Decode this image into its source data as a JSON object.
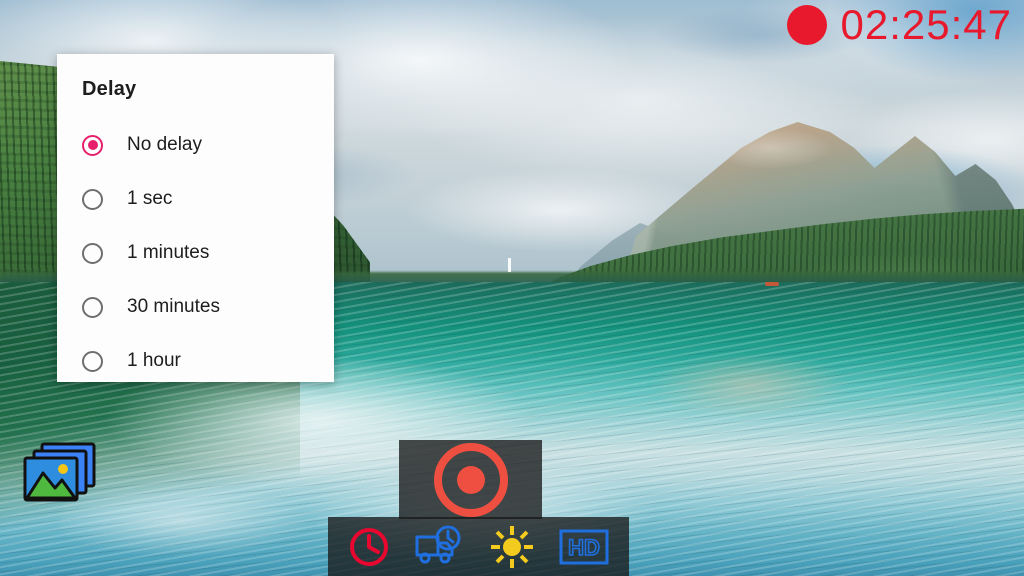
{
  "app": {
    "name": "camera-recorder",
    "viewfinder_scene": "mountain-lake-landscape"
  },
  "recording": {
    "indicator_icon": "record-dot-icon",
    "elapsed_time": "02:25:47",
    "color": "#e8192c",
    "is_recording": true
  },
  "dialog": {
    "title": "Delay",
    "selected_index": 0,
    "accent_color": "#e8206c",
    "options": [
      {
        "label": "No delay",
        "selected": true
      },
      {
        "label": "1 sec",
        "selected": false
      },
      {
        "label": "1 minutes",
        "selected": false
      },
      {
        "label": "30 minutes",
        "selected": false
      },
      {
        "label": "1 hour",
        "selected": false
      }
    ]
  },
  "gallery": {
    "icon": "gallery-stack-icon",
    "label": "Gallery"
  },
  "controls": {
    "record_button": {
      "icon": "record-circle-icon",
      "label": "Record",
      "color": "#ef4f41"
    },
    "tools": [
      {
        "name": "delay-timer",
        "icon": "clock-icon",
        "label": "Delay",
        "color": "#e8082f"
      },
      {
        "name": "scheduled-recording",
        "icon": "truck-clock-icon",
        "label": "Schedule",
        "color": "#1f6fe0"
      },
      {
        "name": "brightness",
        "icon": "sun-icon",
        "label": "Brightness",
        "color": "#f2cb1e"
      },
      {
        "name": "video-quality",
        "icon": "hd-icon",
        "label": "HD",
        "color": "#1f6fe0"
      }
    ]
  }
}
